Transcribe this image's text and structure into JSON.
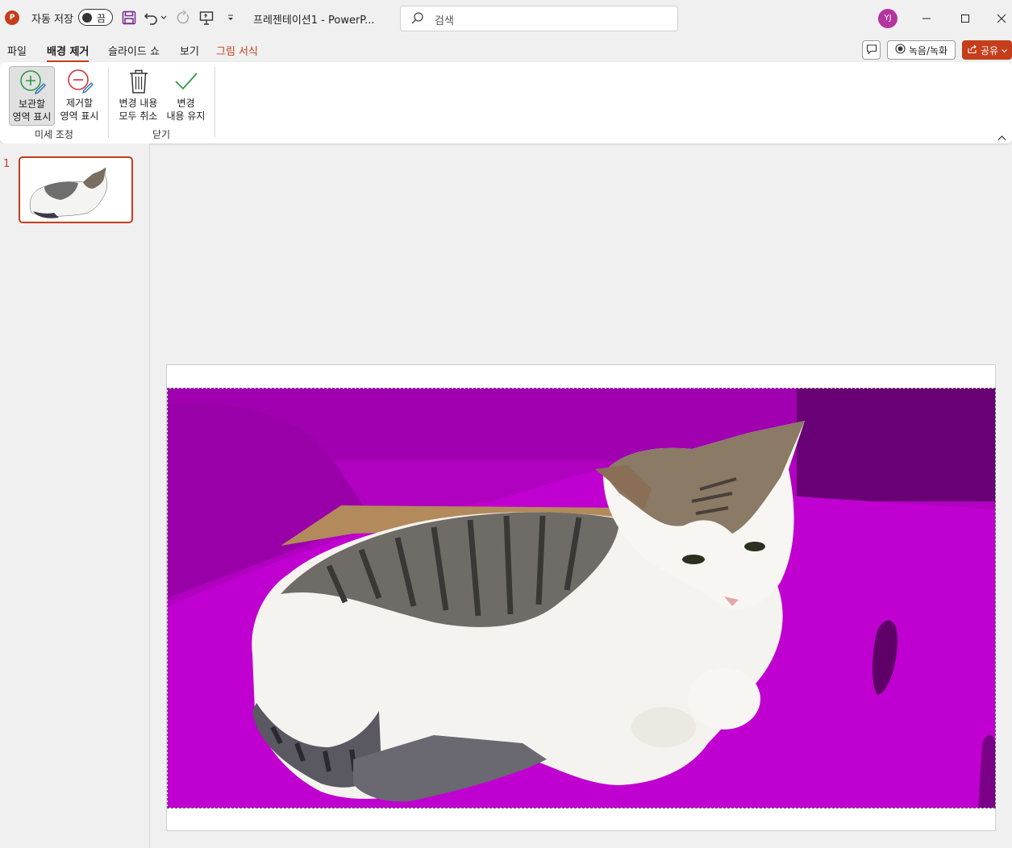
{
  "titlebar": {
    "autosave_label": "자동 저장",
    "autosave_state": "끔",
    "doc_title": "프레젠테이션1  -  PowerP...",
    "search_placeholder": "검색",
    "user_initials": "YJ"
  },
  "tabs": {
    "file": "파일",
    "background_removal": "배경 제거",
    "slideshow": "슬라이드 쇼",
    "view": "보기",
    "picture_format": "그림 서식"
  },
  "right_buttons": {
    "record": "녹음/녹화",
    "share": "공유"
  },
  "ribbon": {
    "mark_keep_line1": "보관할",
    "mark_keep_line2": "영역 표시",
    "mark_remove_line1": "제거할",
    "mark_remove_line2": "영역 표시",
    "discard_line1": "변경 내용",
    "discard_line2": "모두 취소",
    "keep_changes_line1": "변경",
    "keep_changes_line2": "내용 유지",
    "group_refine": "미세 조정",
    "group_close": "닫기"
  },
  "slides": {
    "current_number": "1"
  },
  "colors": {
    "accent": "#c43e1c",
    "removal_overlay": "#b000c0",
    "avatar": "#b4359e"
  }
}
